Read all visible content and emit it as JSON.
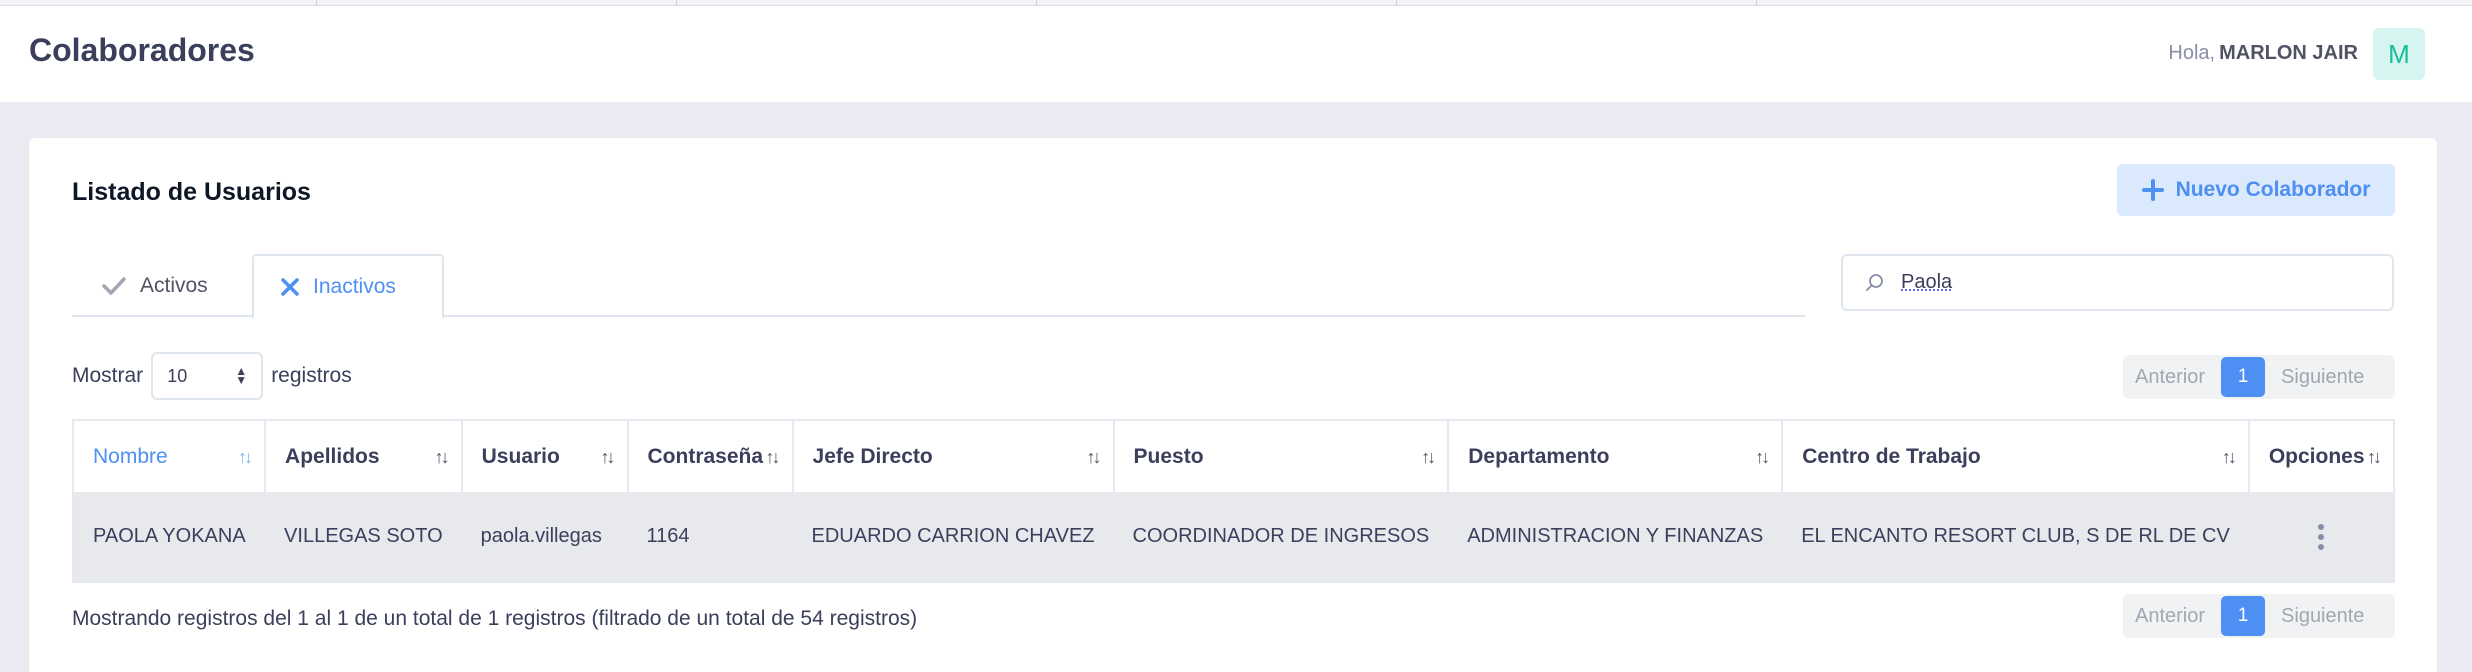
{
  "page": {
    "title": "Colaboradores"
  },
  "user": {
    "greeting": "Hola,",
    "name": "MARLON JAIR",
    "avatar_initial": "M"
  },
  "card": {
    "title": "Listado de Usuarios",
    "new_button": "Nuevo Colaborador"
  },
  "tabs": [
    {
      "label": "Activos",
      "icon": "check-icon",
      "active": false
    },
    {
      "label": "Inactivos",
      "icon": "x-icon",
      "active": true
    }
  ],
  "search": {
    "value": "Paola"
  },
  "length": {
    "prefix": "Mostrar",
    "value": "10",
    "suffix": "registros"
  },
  "pagination": {
    "prev": "Anterior",
    "page": "1",
    "next": "Siguiente"
  },
  "table": {
    "columns": [
      "Nombre",
      "Apellidos",
      "Usuario",
      "Contraseña",
      "Jefe Directo",
      "Puesto",
      "Departamento",
      "Centro de Trabajo",
      "Opciones"
    ],
    "sorted_column": "Nombre",
    "rows": [
      [
        "PAOLA YOKANA",
        "VILLEGAS SOTO",
        "paola.villegas",
        "1164",
        "EDUARDO CARRION CHAVEZ",
        "COORDINADOR DE INGRESOS",
        "ADMINISTRACION Y FINANZAS",
        "EL ENCANTO RESORT CLUB, S DE RL DE CV"
      ]
    ]
  },
  "info": "Mostrando registros del 1 al 1 de un total de 1 registros (filtrado de un total de 54 registros)",
  "colors": {
    "accent": "#4d8ff2",
    "avatar_bg": "#d6f5f1",
    "avatar_fg": "#1abc9c",
    "row_bg": "#e8e9ed"
  }
}
